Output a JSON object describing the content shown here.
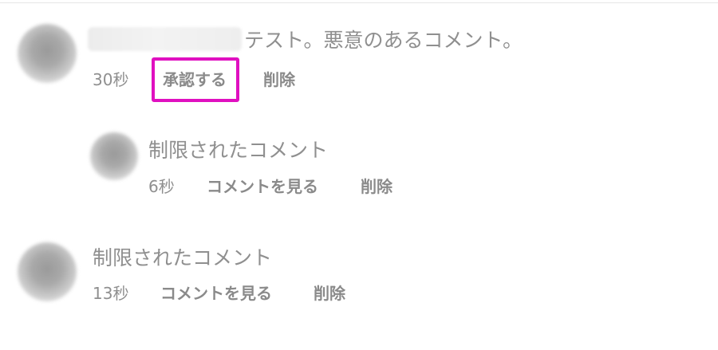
{
  "comments": [
    {
      "text": "テスト。悪意のあるコメント。",
      "time": "30秒",
      "approve_label": "承認する",
      "delete_label": "削除"
    },
    {
      "text": "制限されたコメント",
      "time": "6秒",
      "view_label": "コメントを見る",
      "delete_label": "削除"
    },
    {
      "text": "制限されたコメント",
      "time": "13秒",
      "view_label": "コメントを見る",
      "delete_label": "削除"
    }
  ],
  "colors": {
    "highlight": "#e010c0",
    "text": "#8f8f8f"
  }
}
